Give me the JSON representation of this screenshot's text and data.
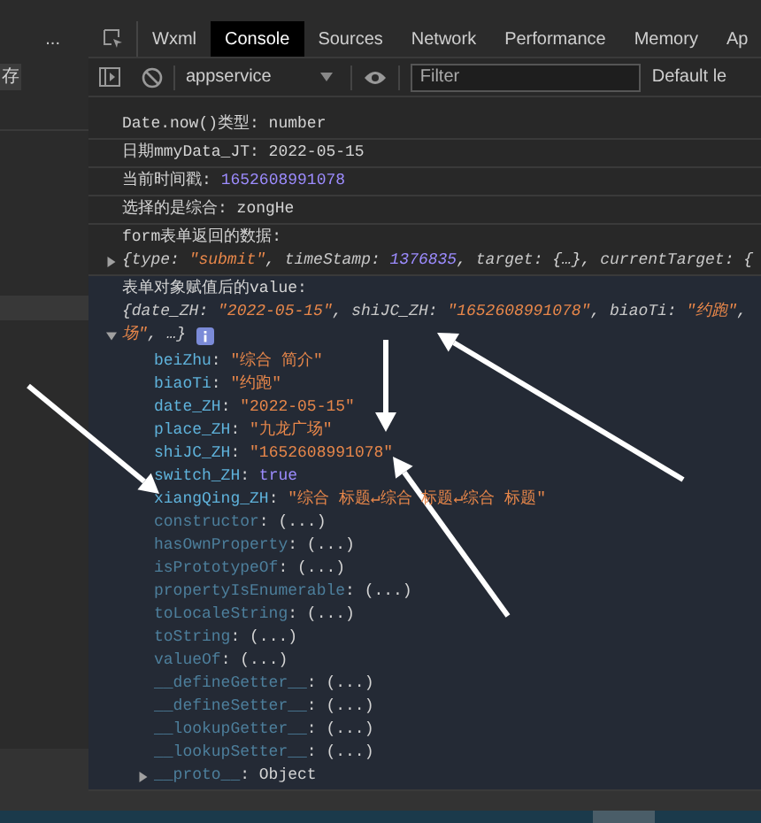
{
  "side_panel": {
    "more": "...",
    "save_button": "存"
  },
  "tabs": [
    {
      "label": "Wxml",
      "selected": false
    },
    {
      "label": "Console",
      "selected": true
    },
    {
      "label": "Sources",
      "selected": false
    },
    {
      "label": "Network",
      "selected": false
    },
    {
      "label": "Performance",
      "selected": false
    },
    {
      "label": "Memory",
      "selected": false
    },
    {
      "label": "Ap",
      "selected": false
    }
  ],
  "toolbar": {
    "context": "appservice",
    "filter": {
      "placeholder": "Filter"
    },
    "levels": "Default le"
  },
  "logs": [
    {
      "kind": "plain",
      "parts": [
        {
          "text": "Date.now()类型: number",
          "kind": "text"
        }
      ]
    },
    {
      "kind": "plain",
      "parts": [
        {
          "text": "日期mmyData_JT: 2022-05-15",
          "kind": "text"
        }
      ]
    },
    {
      "kind": "plain",
      "parts": [
        {
          "text": "当前时间戳: ",
          "kind": "text"
        },
        {
          "text": "1652608991078",
          "kind": "number"
        }
      ]
    },
    {
      "kind": "plain",
      "parts": [
        {
          "text": "选择的是综合: zongHe",
          "kind": "text"
        }
      ]
    },
    {
      "kind": "object",
      "label": "form表单返回的数据:",
      "expanded": false,
      "preview_lines": [
        [
          {
            "text": "{",
            "kind": "punct"
          },
          {
            "text": "type",
            "kind": "key"
          },
          {
            "text": ": ",
            "kind": "punct"
          },
          {
            "text": "\"submit\"",
            "kind": "string"
          },
          {
            "text": ", ",
            "kind": "punct"
          },
          {
            "text": "timeStamp",
            "kind": "key"
          },
          {
            "text": ": ",
            "kind": "punct"
          },
          {
            "text": "1376835",
            "kind": "number"
          },
          {
            "text": ", ",
            "kind": "punct"
          },
          {
            "text": "target",
            "kind": "key"
          },
          {
            "text": ": {…}, ",
            "kind": "punct"
          },
          {
            "text": "currentTarget",
            "kind": "key"
          },
          {
            "text": ": {",
            "kind": "punct"
          }
        ]
      ]
    },
    {
      "kind": "object",
      "label": "表单对象赋值后的value:",
      "expanded": true,
      "preview_lines": [
        [
          {
            "text": "{",
            "kind": "punct"
          },
          {
            "text": "date_ZH",
            "kind": "key"
          },
          {
            "text": ": ",
            "kind": "punct"
          },
          {
            "text": "\"2022-05-15\"",
            "kind": "string"
          },
          {
            "text": ", ",
            "kind": "punct"
          },
          {
            "text": "shiJC_ZH",
            "kind": "key"
          },
          {
            "text": ": ",
            "kind": "punct"
          },
          {
            "text": "\"1652608991078\"",
            "kind": "string"
          },
          {
            "text": ", ",
            "kind": "punct"
          },
          {
            "text": "biaoTi",
            "kind": "key"
          },
          {
            "text": ": ",
            "kind": "punct"
          },
          {
            "text": "\"约跑\"",
            "kind": "string"
          },
          {
            "text": ",",
            "kind": "punct"
          }
        ],
        [
          {
            "text": "场\"",
            "kind": "string"
          },
          {
            "text": ", …}",
            "kind": "punct"
          }
        ]
      ],
      "properties": [
        {
          "inherited": false,
          "parts": [
            {
              "text": "beiZhu",
              "kind": "key"
            },
            {
              "text": ": ",
              "kind": "punct"
            },
            {
              "text": "\"综合 简介\"",
              "kind": "string"
            }
          ]
        },
        {
          "inherited": false,
          "parts": [
            {
              "text": "biaoTi",
              "kind": "key"
            },
            {
              "text": ": ",
              "kind": "punct"
            },
            {
              "text": "\"约跑\"",
              "kind": "string"
            }
          ]
        },
        {
          "inherited": false,
          "parts": [
            {
              "text": "date_ZH",
              "kind": "key"
            },
            {
              "text": ": ",
              "kind": "punct"
            },
            {
              "text": "\"2022-05-15\"",
              "kind": "string"
            }
          ]
        },
        {
          "inherited": false,
          "parts": [
            {
              "text": "place_ZH",
              "kind": "key"
            },
            {
              "text": ": ",
              "kind": "punct"
            },
            {
              "text": "\"九龙广场\"",
              "kind": "string"
            }
          ]
        },
        {
          "inherited": false,
          "parts": [
            {
              "text": "shiJC_ZH",
              "kind": "key"
            },
            {
              "text": ": ",
              "kind": "punct"
            },
            {
              "text": "\"1652608991078\"",
              "kind": "string"
            }
          ]
        },
        {
          "inherited": false,
          "parts": [
            {
              "text": "switch_ZH",
              "kind": "key"
            },
            {
              "text": ": ",
              "kind": "punct"
            },
            {
              "text": "true",
              "kind": "boolean"
            }
          ]
        },
        {
          "inherited": false,
          "parts": [
            {
              "text": "xiangQing_ZH",
              "kind": "key"
            },
            {
              "text": ": ",
              "kind": "punct"
            },
            {
              "text": "\"综合 标题↵综合 标题↵综合 标题\"",
              "kind": "string"
            }
          ]
        },
        {
          "inherited": true,
          "parts": [
            {
              "text": "constructor",
              "kind": "key"
            },
            {
              "text": ": (...)",
              "kind": "punct"
            }
          ]
        },
        {
          "inherited": true,
          "parts": [
            {
              "text": "hasOwnProperty",
              "kind": "key"
            },
            {
              "text": ": (...)",
              "kind": "punct"
            }
          ]
        },
        {
          "inherited": true,
          "parts": [
            {
              "text": "isPrototypeOf",
              "kind": "key"
            },
            {
              "text": ": (...)",
              "kind": "punct"
            }
          ]
        },
        {
          "inherited": true,
          "parts": [
            {
              "text": "propertyIsEnumerable",
              "kind": "key"
            },
            {
              "text": ": (...)",
              "kind": "punct"
            }
          ]
        },
        {
          "inherited": true,
          "parts": [
            {
              "text": "toLocaleString",
              "kind": "key"
            },
            {
              "text": ": (...)",
              "kind": "punct"
            }
          ]
        },
        {
          "inherited": true,
          "parts": [
            {
              "text": "toString",
              "kind": "key"
            },
            {
              "text": ": (...)",
              "kind": "punct"
            }
          ]
        },
        {
          "inherited": true,
          "parts": [
            {
              "text": "valueOf",
              "kind": "key"
            },
            {
              "text": ": (...)",
              "kind": "punct"
            }
          ]
        },
        {
          "inherited": true,
          "parts": [
            {
              "text": "__defineGetter__",
              "kind": "key"
            },
            {
              "text": ": (...)",
              "kind": "punct"
            }
          ]
        },
        {
          "inherited": true,
          "parts": [
            {
              "text": "__defineSetter__",
              "kind": "key"
            },
            {
              "text": ": (...)",
              "kind": "punct"
            }
          ]
        },
        {
          "inherited": true,
          "parts": [
            {
              "text": "__lookupGetter__",
              "kind": "key"
            },
            {
              "text": ": (...)",
              "kind": "punct"
            }
          ]
        },
        {
          "inherited": true,
          "parts": [
            {
              "text": "__lookupSetter__",
              "kind": "key"
            },
            {
              "text": ": (...)",
              "kind": "punct"
            }
          ]
        }
      ],
      "proto": {
        "expanded": false,
        "inherited": true,
        "parts": [
          {
            "text": "__proto__",
            "kind": "key"
          },
          {
            "text": ": Object",
            "kind": "punct"
          }
        ]
      }
    }
  ]
}
